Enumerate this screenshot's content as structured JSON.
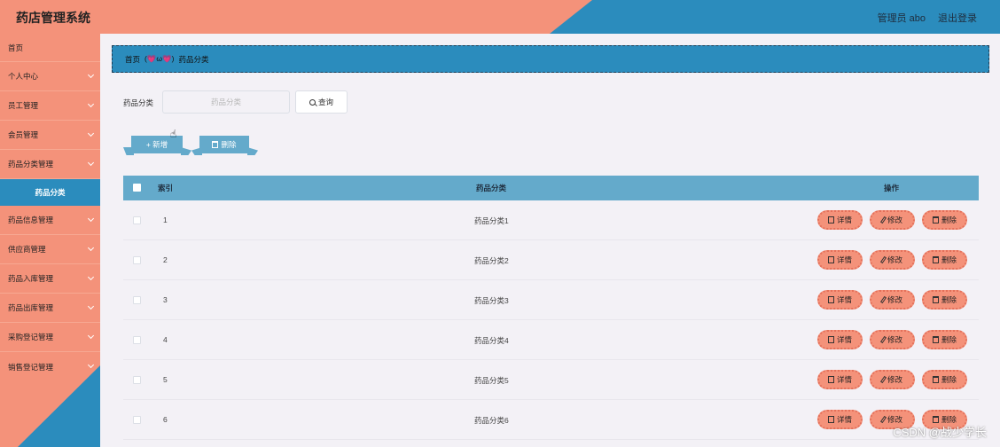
{
  "header": {
    "title": "药店管理系统",
    "user": "管理员 abo",
    "logout": "退出登录"
  },
  "sidebar": {
    "items": [
      {
        "label": "首页"
      },
      {
        "label": "个人中心"
      },
      {
        "label": "员工管理"
      },
      {
        "label": "会员管理"
      },
      {
        "label": "药品分类管理"
      },
      {
        "label": "药品分类"
      },
      {
        "label": "药品信息管理"
      },
      {
        "label": "供应商管理"
      },
      {
        "label": "药品入库管理"
      },
      {
        "label": "药品出库管理"
      },
      {
        "label": "采购登记管理"
      },
      {
        "label": "销售登记管理"
      }
    ]
  },
  "breadcrumb": {
    "home": "首页",
    "sep": "(💗ω💗)",
    "current": "药品分类"
  },
  "search": {
    "label": "药品分类",
    "placeholder": "药品分类",
    "query_label": "查询"
  },
  "toolbar": {
    "add_label": "+ 新增",
    "delete_label": "删除"
  },
  "table": {
    "headers": {
      "index": "索引",
      "category": "药品分类",
      "ops": "操作"
    },
    "rows": [
      {
        "index": "1",
        "category": "药品分类1"
      },
      {
        "index": "2",
        "category": "药品分类2"
      },
      {
        "index": "3",
        "category": "药品分类3"
      },
      {
        "index": "4",
        "category": "药品分类4"
      },
      {
        "index": "5",
        "category": "药品分类5"
      },
      {
        "index": "6",
        "category": "药品分类6"
      }
    ],
    "actions": {
      "detail": "详情",
      "edit": "修改",
      "delete": "删除"
    }
  },
  "watermark": "CSDN @战少学长",
  "colors": {
    "accent_blue": "#2b8cbd",
    "salmon": "#f4927a",
    "light_blue": "#64aacb"
  }
}
